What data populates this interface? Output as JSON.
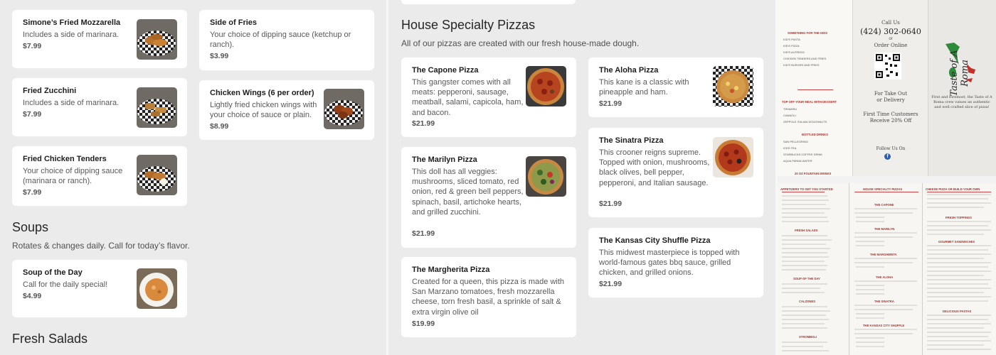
{
  "left": {
    "appetizers": [
      {
        "name": "Simone’s Fried Mozzarella",
        "desc": "Includes a side of marinara.",
        "price": "$7.99"
      },
      {
        "name": "Fried Zucchini",
        "desc": "Includes a side of marinara.",
        "price": "$7.99"
      },
      {
        "name": "Fried Chicken Tenders",
        "desc": "Your choice of dipping sauce (marinara or ranch).",
        "price": "$7.99"
      },
      {
        "name": "Side of Fries",
        "desc": "Your choice of dipping sauce (ketchup or ranch).",
        "price": "$3.99"
      },
      {
        "name": "Chicken Wings (6 per order)",
        "desc": "Lightly fried chicken wings with your choice of sauce or plain.",
        "price": "$8.99"
      }
    ],
    "soups": {
      "title": "Soups",
      "subtitle": "Rotates & changes daily. Call for today’s flavor.",
      "items": [
        {
          "name": "Soup of the Day",
          "desc": "Call for the daily special!",
          "price": "$4.99"
        }
      ]
    },
    "salads": {
      "title": "Fresh Salads"
    }
  },
  "middle": {
    "title": "House Specialty Pizzas",
    "subtitle": "All of our pizzas are created with our fresh house-made dough.",
    "items": [
      {
        "name": "The Capone Pizza",
        "desc": "This gangster comes with all meats: pepperoni, sausage, meatball, salami, capicola, ham, and bacon.",
        "price": "$21.99"
      },
      {
        "name": "The Aloha Pizza",
        "desc": "This kane is a classic with pineapple and ham.",
        "price": "$21.99"
      },
      {
        "name": "The Marilyn Pizza",
        "desc": "This doll has all veggies: mushrooms, sliced tomato, red onion, red & green bell peppers, spinach, basil, artichoke hearts, and grilled zucchini.",
        "price": "$21.99"
      },
      {
        "name": "The Sinatra Pizza",
        "desc": "This crooner reigns supreme. Topped with onion, mushrooms, black olives, bell pepper, pepperoni, and Italian sausage.",
        "price": "$21.99"
      },
      {
        "name": "The Margherita Pizza",
        "desc": "Created for a queen, this pizza is made with San Marzano tomatoes, fresh mozzarella cheese, torn fresh basil, a sprinkle of salt & extra virgin olive oil",
        "price": "$19.99"
      },
      {
        "name": "The Kansas City Shuffle Pizza",
        "desc": "This midwest masterpiece is topped with world-famous gates bbq sauce, grilled chicken, and grilled onions.",
        "price": "$21.99"
      }
    ]
  },
  "brochure": {
    "call_us": "Call Us",
    "phone": "(424) 302-0640",
    "or": "or",
    "order_online": "Order Online",
    "take_out": "For Take Out",
    "or_delivery": "or Delivery",
    "first_time": "First Time Customers",
    "discount": "Receive 20% Off",
    "follow": "Follow Us On",
    "logo": "Taste of A Roma",
    "tagline": "First and foremost, the Taste of A Roma crew values an authentic and well crafted slice of pizza!",
    "left_panel_items": [
      "SOMETHING FOR THE KIDS",
      "KID'S PASTA",
      "KID'S PIZZA",
      "KID'S ALFREDO",
      "CHICKEN TENDERS AND FRIES",
      "KID'S BURGER AND FRIES",
      "TOP OFF YOUR MEAL WITH DESSERT",
      "TIRAMISU",
      "CANNOLI",
      "ZEPPOLE ITALIAN DOUGHNUTS",
      "BOTTLED DRINKS",
      "SAN PELLEGRINO",
      "ICED TEA",
      "STARBUCKS COFFEE DRINK",
      "AQUA PANNA WATER",
      "20 OZ FOUNTAIN DRINKS"
    ],
    "bottom_headers": [
      "APPETIZERS TO GET YOU STARTED",
      "HOUSE SPECIALTY PIZZAS",
      "CHEESE PIZZA OR BUILD YOUR OWN"
    ],
    "bottom_sections_left": [
      "FRESH SALADS",
      "SOUP OF THE DAY",
      "CALZONES",
      "STROMBOLI"
    ],
    "bottom_sections_mid": [
      "THE CAPONE",
      "THE MARILYN",
      "THE MARGHERITA",
      "THE ALOHA",
      "THE SINATRA",
      "THE KANSAS CITY SHUFFLE"
    ],
    "bottom_sections_right": [
      "FRESH TOPPINGS",
      "GOURMET SANDWICHES",
      "DELICIOUS PASTAS"
    ]
  },
  "colors": {
    "page_bg": "#ebebeb",
    "card_bg": "#ffffff",
    "accent_red": "#b0302a",
    "italy_green": "#2e8b3a"
  }
}
